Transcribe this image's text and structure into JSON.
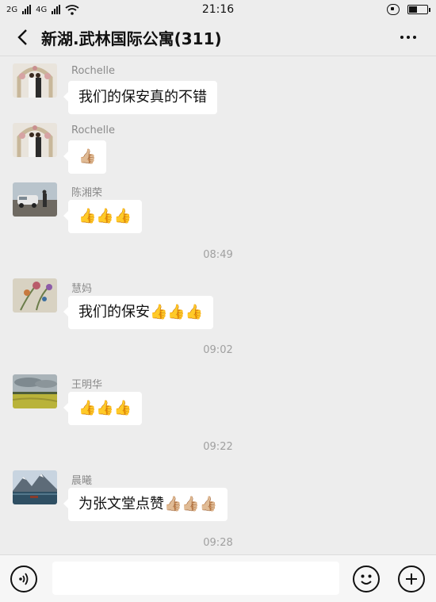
{
  "status_bar": {
    "network_1": "2G",
    "network_2": "4G",
    "time": "21:16"
  },
  "header": {
    "title": "新湖.武林国际公寓(311)"
  },
  "messages": [
    {
      "sender": "Rochelle",
      "text": "我们的保安真的不错",
      "thumbs": 0,
      "avatar": "wedding-photo-avatar"
    },
    {
      "sender": "Rochelle",
      "text": "",
      "thumbs": 1,
      "avatar": "wedding-photo-avatar"
    },
    {
      "sender": "陈湘荣",
      "text": "",
      "thumbs": 3,
      "avatar": "car-photo-avatar"
    },
    {
      "sender": "慧妈",
      "text": "我们的保安",
      "thumbs": 3,
      "avatar": "flower-painting-avatar"
    },
    {
      "sender": "王明华",
      "text": "",
      "thumbs": 3,
      "avatar": "field-landscape-avatar"
    },
    {
      "sender": "晨曦",
      "text": "为张文堂点赞",
      "thumbs": 3,
      "avatar": "mountain-lake-avatar"
    }
  ],
  "timestamps": [
    "08:49",
    "09:02",
    "09:22",
    "09:28"
  ],
  "input_bar": {
    "placeholder": ""
  },
  "colors": {
    "background": "#ededed",
    "bubble": "#ffffff",
    "sender_text": "#8b8b8b",
    "timestamp_text": "#a0a0a0"
  }
}
